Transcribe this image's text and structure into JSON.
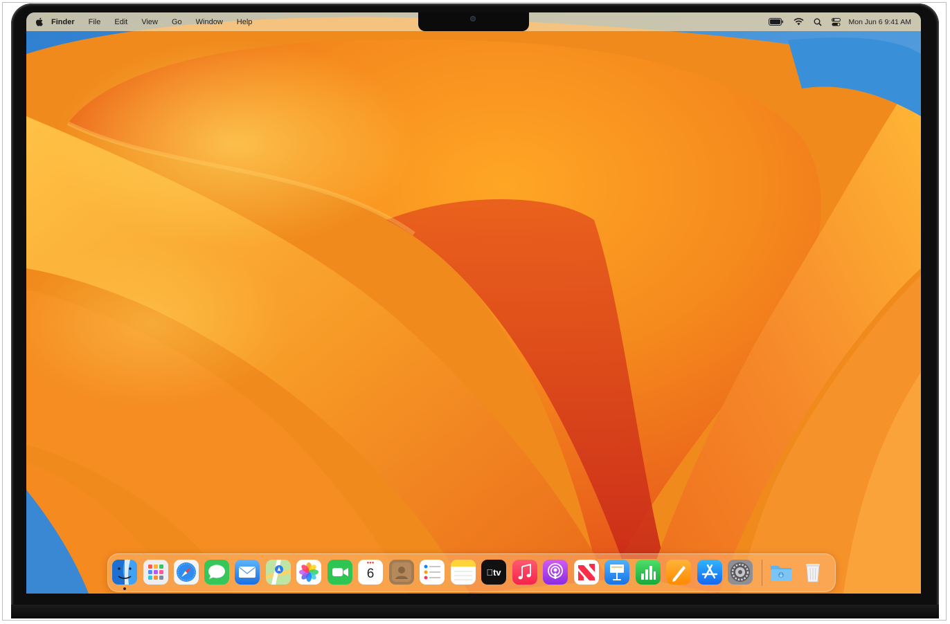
{
  "menubar": {
    "app_name": "Finder",
    "items": [
      "File",
      "Edit",
      "View",
      "Go",
      "Window",
      "Help"
    ],
    "clock": "Mon Jun 6  9:41 AM"
  },
  "status_icons": [
    "battery-icon",
    "wifi-icon",
    "search-icon",
    "control-center-icon"
  ],
  "dock": {
    "apps": [
      {
        "name": "Finder",
        "icon": "finder-icon",
        "running": true
      },
      {
        "name": "Launchpad",
        "icon": "launchpad-icon",
        "running": false
      },
      {
        "name": "Safari",
        "icon": "safari-icon",
        "running": false
      },
      {
        "name": "Messages",
        "icon": "messages-icon",
        "running": false
      },
      {
        "name": "Mail",
        "icon": "mail-icon",
        "running": false
      },
      {
        "name": "Maps",
        "icon": "maps-icon",
        "running": false
      },
      {
        "name": "Photos",
        "icon": "photos-icon",
        "running": false
      },
      {
        "name": "FaceTime",
        "icon": "facetime-icon",
        "running": false
      },
      {
        "name": "Calendar",
        "icon": "calendar-icon",
        "running": false
      },
      {
        "name": "Contacts",
        "icon": "contacts-icon",
        "running": false
      },
      {
        "name": "Reminders",
        "icon": "reminders-icon",
        "running": false
      },
      {
        "name": "Notes",
        "icon": "notes-icon",
        "running": false
      },
      {
        "name": "TV",
        "icon": "tv-icon",
        "running": false
      },
      {
        "name": "Music",
        "icon": "music-icon",
        "running": false
      },
      {
        "name": "Podcasts",
        "icon": "podcasts-icon",
        "running": false
      },
      {
        "name": "News",
        "icon": "news-icon",
        "running": false
      },
      {
        "name": "Keynote",
        "icon": "keynote-icon",
        "running": false
      },
      {
        "name": "Numbers",
        "icon": "numbers-icon",
        "running": false
      },
      {
        "name": "Pages",
        "icon": "pages-icon",
        "running": false
      },
      {
        "name": "App Store",
        "icon": "app-store-icon",
        "running": false
      },
      {
        "name": "System Settings",
        "icon": "system-settings-icon",
        "running": false
      }
    ],
    "calendar_day": "6",
    "tv_label": "tv",
    "trailing": [
      {
        "name": "Downloads",
        "icon": "downloads-folder-icon"
      },
      {
        "name": "Trash",
        "icon": "trash-icon"
      }
    ]
  },
  "colors": {
    "wallpaper_orange": "#f5901e",
    "wallpaper_red": "#d8341a",
    "wallpaper_yellow": "#ffc83a",
    "wallpaper_blue": "#3b8fd6",
    "bezel": "#0e0e0f"
  }
}
